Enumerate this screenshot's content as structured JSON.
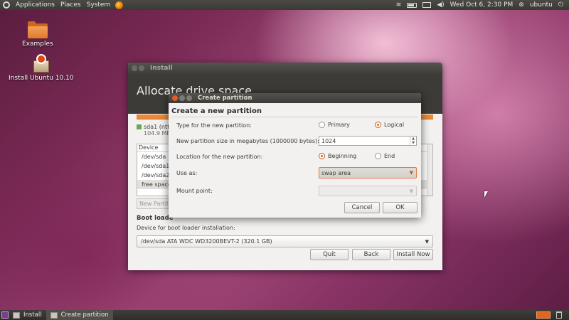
{
  "top_panel": {
    "menus": [
      "Applications",
      "Places",
      "System"
    ],
    "datetime": "Wed Oct  6,  2:30 PM",
    "user": "ubuntu"
  },
  "desktop": {
    "icons": [
      {
        "label": "Examples",
        "icon": "folder-icon"
      },
      {
        "label": "Install Ubuntu 10.10",
        "icon": "installer-icon"
      }
    ]
  },
  "install_window": {
    "title": "Install",
    "header": "Allocate drive space",
    "partition_legend": {
      "name": "sda1 (ntf",
      "size": "104.9 ME"
    },
    "table": {
      "column_header": "Device",
      "rows": [
        "/dev/sda",
        "/dev/sda1",
        "/dev/sda2",
        "free space"
      ]
    },
    "new_partition_button": "New Partiti",
    "boot_loader_label": "Boot loade",
    "boot_loader_device_label": "Device for boot loader installation:",
    "boot_loader_device_value": "/dev/sda ATA WDC WD3200BEVT-2 (320.1 GB)",
    "buttons": {
      "quit": "Quit",
      "back": "Back",
      "install_now": "Install Now"
    }
  },
  "dialog": {
    "title": "Create partition",
    "heading": "Create a new partition",
    "type_label": "Type for the new partition:",
    "type_options": [
      {
        "label": "Primary",
        "selected": false
      },
      {
        "label": "Logical",
        "selected": true
      }
    ],
    "size_label": "New partition size in megabytes (1000000 bytes):",
    "size_value": "1024",
    "location_label": "Location for the new partition:",
    "location_options": [
      {
        "label": "Beginning",
        "selected": true
      },
      {
        "label": "End",
        "selected": false
      }
    ],
    "use_as_label": "Use as:",
    "use_as_value": "swap area",
    "mount_point_label": "Mount point:",
    "mount_point_value": "",
    "buttons": {
      "cancel": "Cancel",
      "ok": "OK"
    }
  },
  "taskbar": {
    "tasks": [
      {
        "label": "Install",
        "active": false
      },
      {
        "label": "Create partition",
        "active": true
      }
    ]
  },
  "colors": {
    "accent": "#e0661c",
    "partition_bar": "#e88a39",
    "legend_swatch": "#6aa84f"
  }
}
